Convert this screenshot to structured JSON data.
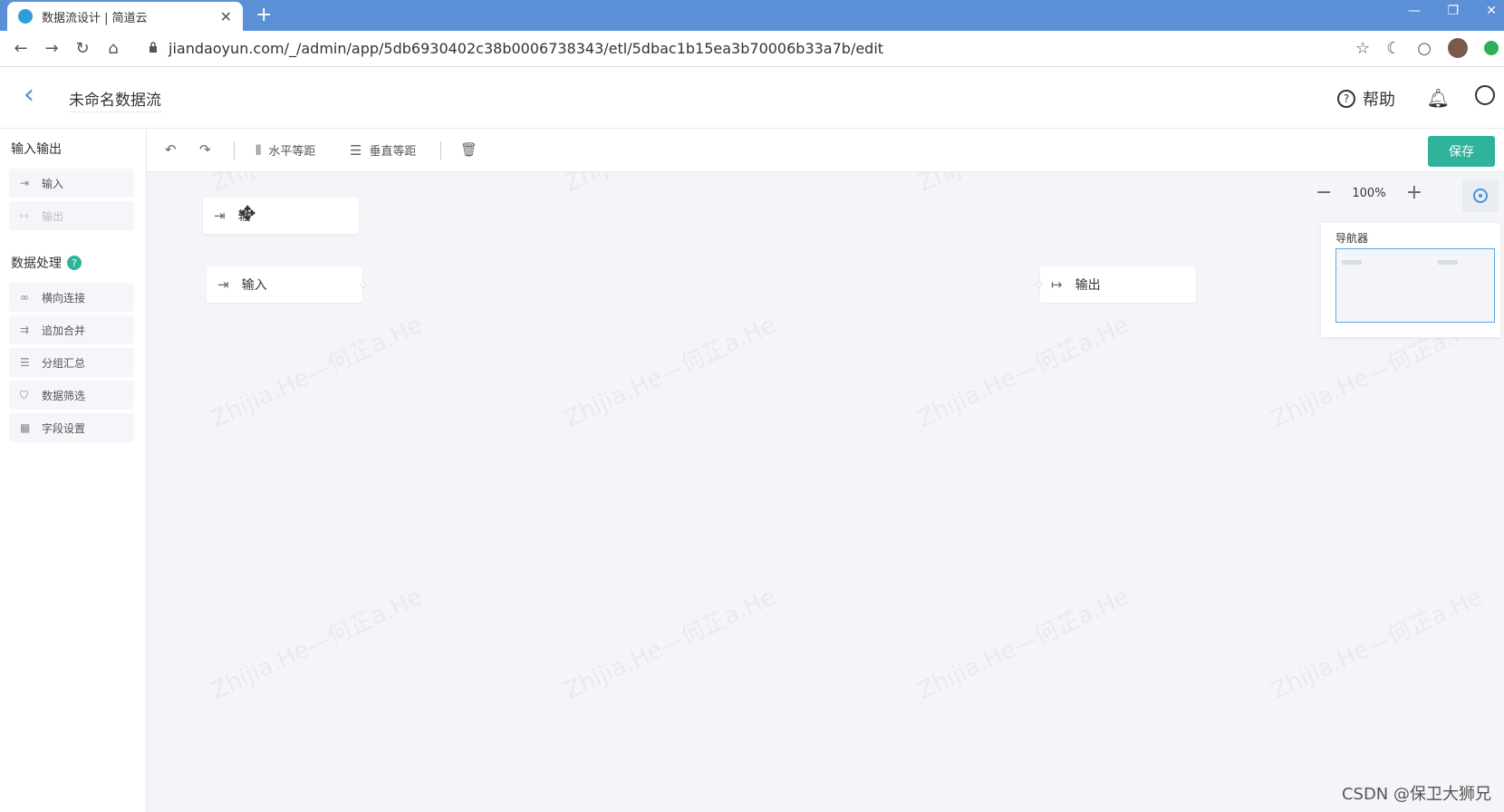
{
  "browser": {
    "tab_title": "数据流设计 | 简道云",
    "tab_close": "✕",
    "new_tab": "+",
    "url": "jiandaoyun.com/_/admin/app/5db6930402c38b0006738343/etl/5dbac1b15ea3b70006b33a7b/edit",
    "win_minimize": "—",
    "win_restore": "❐",
    "win_close": "✕"
  },
  "header": {
    "title": "未命名数据流",
    "help_label": "帮助"
  },
  "left_panel": {
    "io_section": "输入输出",
    "io_items": [
      {
        "label": "输入",
        "icon": "input-icon",
        "disabled": false
      },
      {
        "label": "输出",
        "icon": "output-icon",
        "disabled": true
      }
    ],
    "processing_section": "数据处理",
    "processing_items": [
      {
        "label": "横向连接",
        "icon": "link-icon"
      },
      {
        "label": "追加合并",
        "icon": "merge-icon"
      },
      {
        "label": "分组汇总",
        "icon": "list-icon"
      },
      {
        "label": "数据筛选",
        "icon": "filter-icon"
      },
      {
        "label": "字段设置",
        "icon": "table-icon"
      }
    ]
  },
  "toolbar": {
    "horizontal_label": "水平等距",
    "vertical_label": "垂直等距",
    "save_label": "保存"
  },
  "canvas": {
    "zoom": "100%",
    "navigator_title": "导航器",
    "nodes": [
      {
        "label": "输",
        "type": "input",
        "dragging": true
      },
      {
        "label": "输入",
        "type": "input"
      },
      {
        "label": "输出",
        "type": "output"
      }
    ]
  },
  "watermark_text": "Zhijia.He—何芷a.He",
  "credit": "CSDN @保卫大狮兄"
}
